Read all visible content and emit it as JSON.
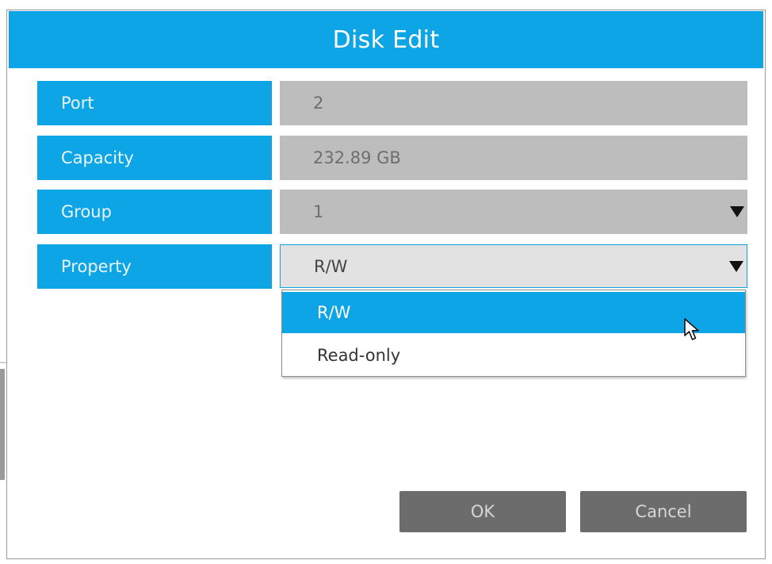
{
  "dialog": {
    "title": "Disk Edit"
  },
  "fields": [
    {
      "label": "Port",
      "value": "2"
    },
    {
      "label": "Capacity",
      "value": "232.89 GB"
    },
    {
      "label": "Group",
      "value": "1"
    },
    {
      "label": "Property",
      "value": "R/W"
    }
  ],
  "property_dropdown": {
    "options": [
      "R/W",
      "Read-only"
    ],
    "highlighted": "R/W"
  },
  "buttons": {
    "ok_label": "OK",
    "cancel_label": "Cancel"
  },
  "colors": {
    "accent": "#0ea5e6",
    "field_bg": "#bdbdbd",
    "button_bg": "#6c6c6c"
  },
  "icons": {
    "dropdown": "caret-down-icon",
    "pointer": "mouse-pointer-icon"
  }
}
